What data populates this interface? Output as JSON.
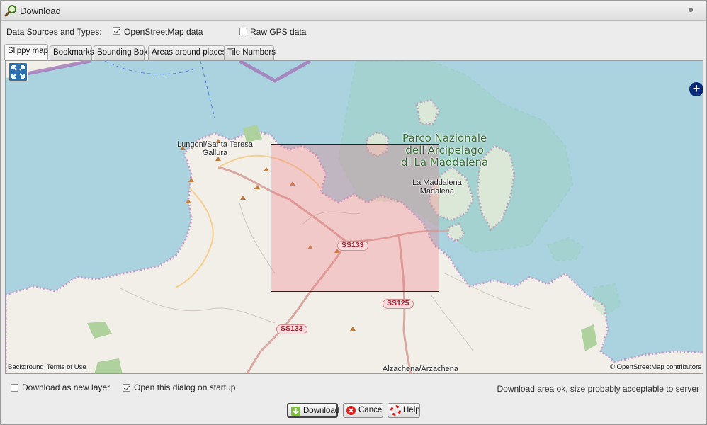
{
  "window": {
    "title": "Download",
    "icon": "magnifier-download-icon"
  },
  "sources": {
    "label": "Data Sources and Types:",
    "osm": {
      "label": "OpenStreetMap data",
      "checked": true
    },
    "gps": {
      "label": "Raw GPS data",
      "checked": false
    }
  },
  "tabs": [
    {
      "label": "Slippy map",
      "active": true
    },
    {
      "label": "Bookmarks",
      "active": false
    },
    {
      "label": "Bounding Box",
      "active": false
    },
    {
      "label": "Areas around places",
      "active": false
    },
    {
      "label": "Tile Numbers",
      "active": false
    }
  ],
  "map": {
    "labels": {
      "town1_line1": "Lungoni/Santa Teresa",
      "town1_line2": "Gallura",
      "park_line1": "Parco Nazionale",
      "park_line2": "dell'Arcipelago",
      "park_line3": "di La Maddalena",
      "town2_line1": "La Maddalena",
      "town2_line2": "Madalena",
      "town3": "Alzachena/Arzachena"
    },
    "road_shields": {
      "ss133_a": "SS133",
      "ss125": "SS125",
      "ss133_b": "SS133"
    },
    "attribution_left": {
      "background": "Background",
      "terms": "Terms of Use"
    },
    "attribution_right": "© OpenStreetMap contributors",
    "controls": {
      "fullscreen": "fullscreen-icon",
      "zoom_in": "+"
    },
    "colors": {
      "sea": "#aad3df",
      "land": "#f2efe9",
      "selection": "#eb7882",
      "park": "#8fd19e"
    }
  },
  "options": {
    "new_layer": {
      "label": "Download as new layer",
      "checked": false
    },
    "open_on_startup": {
      "label": "Open this dialog on startup",
      "checked": true
    }
  },
  "status": "Download area ok, size probably acceptable to server",
  "buttons": {
    "download": "Download",
    "cancel": "Cancel",
    "help": "Help"
  }
}
